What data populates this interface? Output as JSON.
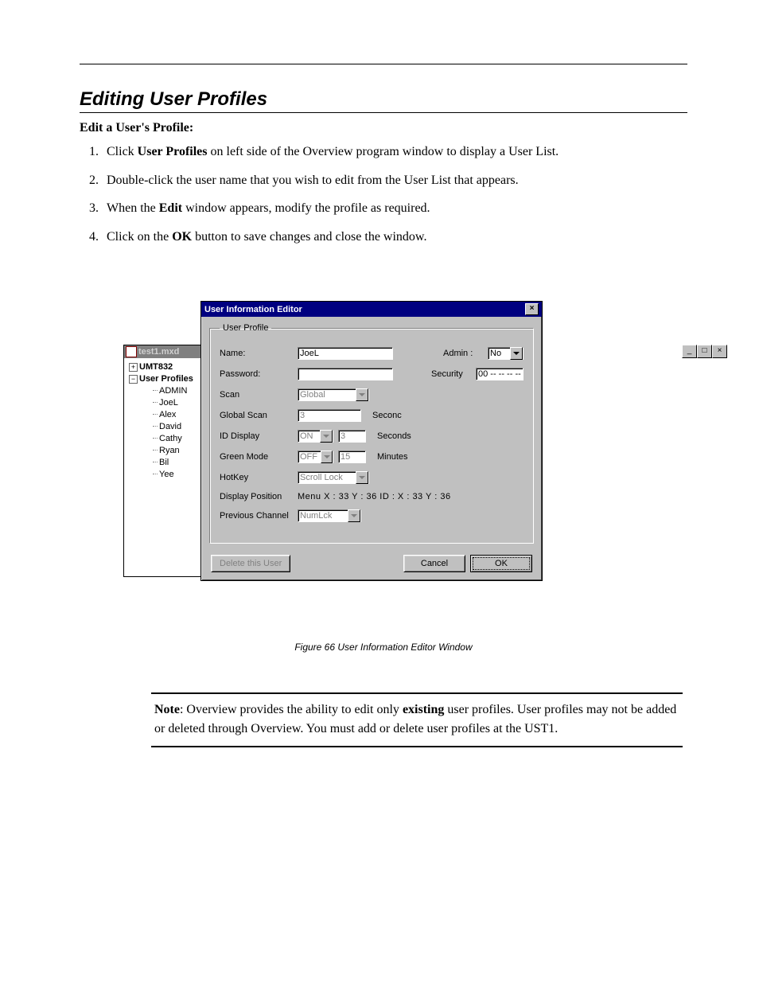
{
  "heading": "Editing User Profiles",
  "subheading": "Edit a User's Profile:",
  "steps": {
    "s1a": "Click ",
    "s1b": "User Profiles",
    "s1c": " on left side of the Overview program window to display a User List.",
    "s2": "Double-click the user name that you wish to edit from the User List that appears.",
    "s3a": "When the ",
    "s3b": "Edit",
    "s3c": " window appears, modify the profile as required.",
    "s4a": "Click on the ",
    "s4b": "OK",
    "s4c": " button to save changes and close the window."
  },
  "figure_caption": "Figure 66  User Information Editor Window",
  "tree": {
    "title": "test1.mxd",
    "root1": "UMT832",
    "root2": "User Profiles",
    "users": [
      "ADMIN",
      "JoeL",
      "Alex",
      "David",
      "Cathy",
      "Ryan",
      "Bil",
      "Yee"
    ]
  },
  "dialog": {
    "title": "User Information Editor",
    "group_legend": "User Profile",
    "labels": {
      "name": "Name:",
      "admin": "Admin :",
      "password": "Password:",
      "security": "Security",
      "scan": "Scan",
      "global_scan": "Global Scan",
      "seconds1": "Seconc",
      "id_display": "ID Display",
      "seconds2": "Seconds",
      "green_mode": "Green Mode",
      "minutes": "Minutes",
      "hotkey": "HotKey",
      "display_position": "Display Position",
      "dp_value": "Menu    X : 33    Y : 36     ID :    X : 33    Y : 36",
      "prev_channel": "Previous Channel"
    },
    "values": {
      "name": "JoeL",
      "admin": "No",
      "password": "",
      "security": "00 -- -- -- --",
      "scan": "Global",
      "global_scan": "3",
      "id_display_mode": "ON",
      "id_display_sec": "3",
      "green_mode": "OFF",
      "green_minutes": "15",
      "hotkey": "Scroll Lock",
      "prev_channel": "NumLck"
    },
    "buttons": {
      "delete": "Delete this User",
      "cancel": "Cancel",
      "ok": "OK"
    }
  },
  "note": {
    "lead": "Note",
    "body1": ":  Overview provides the ability to edit only ",
    "bold1": "existing",
    "body2": " user profiles. User profiles may not be added or deleted through Overview.  You must add or delete user profiles at the UST1."
  }
}
